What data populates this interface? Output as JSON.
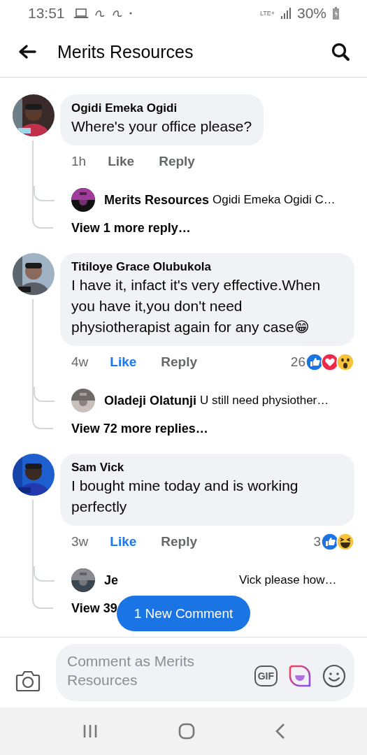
{
  "status_bar": {
    "time": "13:51",
    "network": "LTE+",
    "battery": "30%"
  },
  "header": {
    "title": "Merits Resources"
  },
  "comments": [
    {
      "author": "Ogidi Emeka Ogidi",
      "text": "Where's your office please?",
      "time": "1h",
      "like": "Like",
      "liked": false,
      "reply": "Reply",
      "reply_preview": {
        "author": "Merits Resources",
        "text": "Ogidi Emeka Ogidi C…"
      },
      "more": "View 1 more reply…"
    },
    {
      "author": "Titiloye Grace Olubukola",
      "text": "I have it, infact it's very effective.When you have it,you don't need physiotherapist again for any case😁",
      "time": "4w",
      "like": "Like",
      "liked": true,
      "reply": "Reply",
      "reaction_count": "26",
      "reactions": [
        {
          "kind": "like"
        },
        {
          "kind": "love"
        },
        {
          "kind": "wow"
        }
      ],
      "reply_preview": {
        "author": "Oladeji Olatunji",
        "text": "U still need physiother…"
      },
      "more": "View 72 more replies…"
    },
    {
      "author": "Sam Vick",
      "text": "I bought mine today and is working perfectly",
      "time": "3w",
      "like": "Like",
      "liked": true,
      "reply": "Reply",
      "reaction_count": "3",
      "reactions": [
        {
          "kind": "like"
        },
        {
          "kind": "haha"
        }
      ],
      "reply_preview": {
        "author": "Je",
        "text": "Vick please how…"
      },
      "more": "View 39"
    }
  ],
  "new_comment_button": "1 New Comment",
  "composer": {
    "placeholder": "Comment as Merits Resources",
    "gif": "GIF"
  }
}
